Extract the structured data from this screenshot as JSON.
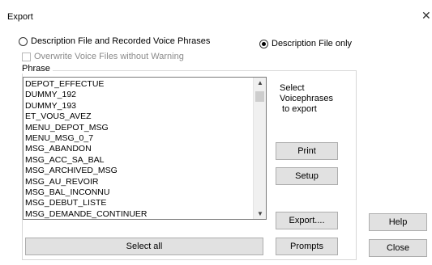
{
  "window": {
    "title": "Export",
    "close_glyph": "✕"
  },
  "options": {
    "radio_full": "Description File and Recorded Voice Phrases",
    "radio_desc_only": "Description File only",
    "selected": "Description File only",
    "overwrite_checkbox": "Overwrite Voice Files without Warning",
    "overwrite_checked": false
  },
  "phrase_group": {
    "label": "Phrase",
    "items": [
      "DEPOT_EFFECTUE",
      "DUMMY_192",
      "DUMMY_193",
      "ET_VOUS_AVEZ",
      "MENU_DEPOT_MSG",
      "MENU_MSG_0_7",
      "MSG_ABANDON",
      "MSG_ACC_SA_BAL",
      "MSG_ARCHIVED_MSG",
      "MSG_AU_REVOIR",
      "MSG_BAL_INCONNU",
      "MSG_DEBUT_LISTE",
      "MSG_DEMANDE_CONTINUER"
    ],
    "info_lines": [
      "Select",
      "Voicephrases",
      " to export"
    ]
  },
  "buttons": {
    "print": "Print",
    "setup": "Setup",
    "export": "Export....",
    "select_all": "Select all",
    "prompts": "Prompts",
    "help": "Help",
    "close": "Close"
  },
  "icons": {
    "close": "close-icon",
    "scroll_up": "chevron-up-icon",
    "scroll_down": "chevron-down-icon"
  }
}
